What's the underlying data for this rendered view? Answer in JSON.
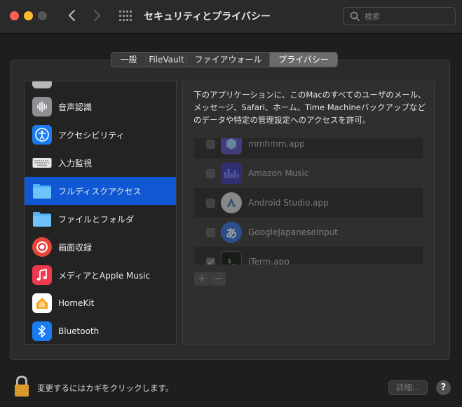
{
  "window": {
    "title": "セキュリティとプライバシー",
    "search_placeholder": "検索"
  },
  "tabs": [
    {
      "label": "一般",
      "selected": false
    },
    {
      "label": "FileVault",
      "selected": false
    },
    {
      "label": "ファイアウォール",
      "selected": false
    },
    {
      "label": "プライバシー",
      "selected": true
    }
  ],
  "sidebar": {
    "items": [
      {
        "label": "音声認識",
        "icon": "waveform-icon"
      },
      {
        "label": "アクセシビリティ",
        "icon": "accessibility-icon"
      },
      {
        "label": "入力監視",
        "icon": "keyboard-icon"
      },
      {
        "label": "フルディスクアクセス",
        "icon": "folder-icon",
        "selected": true
      },
      {
        "label": "ファイルとフォルダ",
        "icon": "folder-icon"
      },
      {
        "label": "画面収録",
        "icon": "screen-record-icon"
      },
      {
        "label": "メディアとApple Music",
        "icon": "music-note-icon"
      },
      {
        "label": "HomeKit",
        "icon": "home-icon"
      },
      {
        "label": "Bluetooth",
        "icon": "bluetooth-icon"
      }
    ]
  },
  "content": {
    "description": "下のアプリケーションに、このMacのすべてのユーザのメール、メッセージ、Safari、ホーム、Time Machineバックアップなどのデータや特定の管理設定へのアクセスを許可。",
    "apps": [
      {
        "name": "mmhmm.app",
        "checked": false
      },
      {
        "name": "Amazon Music",
        "checked": false
      },
      {
        "name": "Android Studio.app",
        "checked": false
      },
      {
        "name": "GoogleJapaneseInput",
        "checked": false
      },
      {
        "name": "iTerm.app",
        "checked": true
      }
    ],
    "add_label": "+",
    "remove_label": "−"
  },
  "footer": {
    "lock_text": "変更するにはカギをクリックします。",
    "details_label": "詳細...",
    "help_label": "?"
  }
}
